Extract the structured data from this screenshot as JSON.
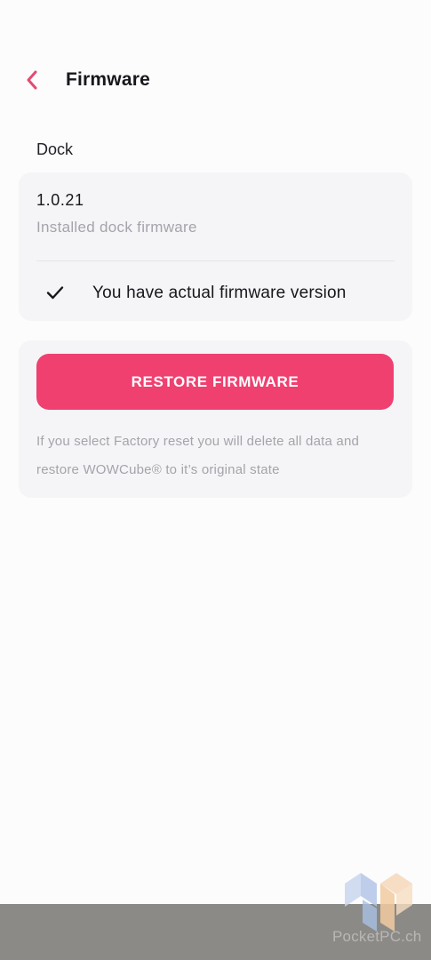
{
  "header": {
    "back_icon": "chevron-left-icon",
    "title": "Firmware"
  },
  "dock_section": {
    "label": "Dock",
    "version": "1.0.21",
    "version_caption": "Installed dock firmware",
    "status_icon": "checkmark-icon",
    "status_text": "You have actual firmware version"
  },
  "restore_section": {
    "button_label": "RESTORE FIRMWARE",
    "note": "If you select Factory reset you will delete all data and restore WOWCube® to it’s original state"
  },
  "watermark": {
    "text": "PocketPC.ch"
  },
  "colors": {
    "accent": "#ef4070",
    "card_background": "#f5f5f7",
    "page_background": "#fcfcfd",
    "muted_text": "#a4a4ab"
  }
}
